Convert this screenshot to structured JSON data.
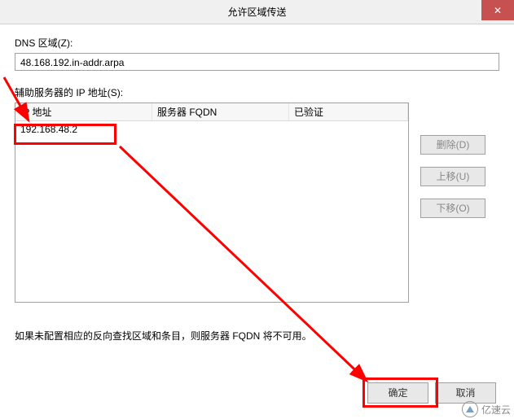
{
  "title": "允许区域传送",
  "close_glyph": "✕",
  "labels": {
    "dns_zone": "DNS 区域(Z):",
    "secondary_servers": "辅助服务器的 IP 地址(S):"
  },
  "zone_value": "48.168.192.in-addr.arpa",
  "table": {
    "headers": {
      "ip": "IP 地址",
      "fqdn": "服务器 FQDN",
      "verified": "已验证"
    },
    "row": {
      "ip_value": "192.168.48.2"
    }
  },
  "side_buttons": {
    "delete": "删除(D)",
    "move_up": "上移(U)",
    "move_down": "下移(O)"
  },
  "note": "如果未配置相应的反向查找区域和条目，则服务器 FQDN 将不可用。",
  "buttons": {
    "ok": "确定",
    "cancel": "取消"
  },
  "watermark": "亿速云"
}
